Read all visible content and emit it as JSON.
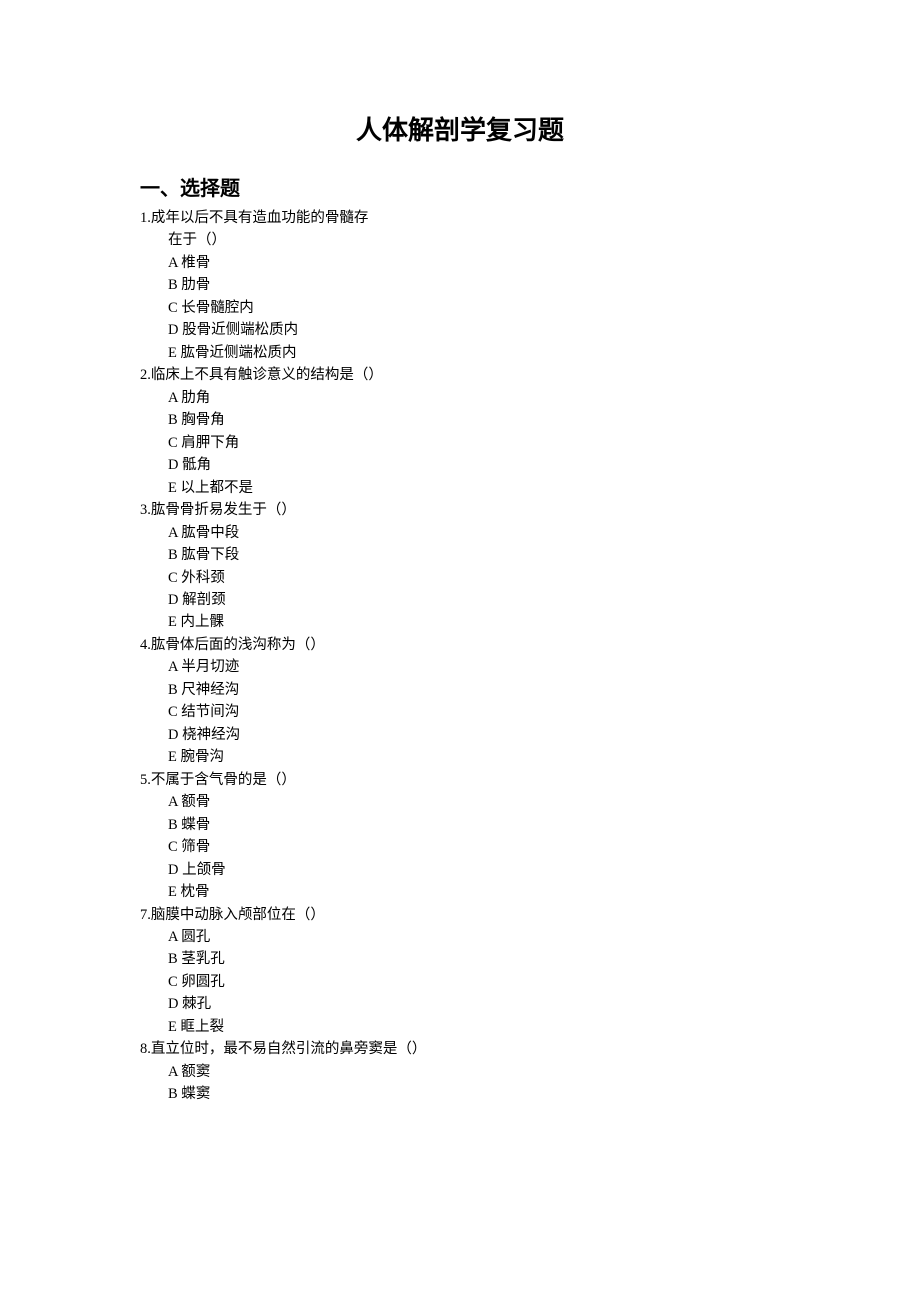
{
  "title": "人体解剖学复习题",
  "section_header": "一、选择题",
  "questions": [
    {
      "number": "1.",
      "text_line1": "成年以后不具有造血功能的骨髓存",
      "text_line2": "在于（）",
      "options": [
        "A 椎骨",
        "B 肋骨",
        "C 长骨髓腔内",
        "D 股骨近侧端松质内",
        "E 肱骨近侧端松质内"
      ]
    },
    {
      "number": "2.",
      "text_line1": "临床上不具有触诊意义的结构是（）",
      "options": [
        "A 肋角",
        "B 胸骨角",
        "C 肩胛下角",
        "D 骶角",
        "E 以上都不是"
      ]
    },
    {
      "number": "3.",
      "text_line1": "肱骨骨折易发生于（）",
      "options": [
        "A 肱骨中段",
        "B 肱骨下段",
        "C 外科颈",
        "D 解剖颈",
        "E 内上髁"
      ]
    },
    {
      "number": "4.",
      "text_line1": "肱骨体后面的浅沟称为（）",
      "options": [
        "A 半月切迹",
        "B 尺神经沟",
        "C 结节间沟",
        "D 桡神经沟",
        "E 腕骨沟"
      ]
    },
    {
      "number": "5.",
      "text_line1": "不属于含气骨的是（）",
      "options": [
        "A 额骨",
        "B 蝶骨",
        "C 筛骨",
        "D 上颌骨",
        "E 枕骨"
      ]
    },
    {
      "number": "7.",
      "text_line1": "脑膜中动脉入颅部位在（）",
      "options": [
        "A 圆孔",
        "B 茎乳孔",
        "C 卵圆孔",
        "D 棘孔",
        "E 眶上裂"
      ]
    },
    {
      "number": "8.",
      "text_line1": "直立位时，最不易自然引流的鼻旁窦是（）",
      "options": [
        "A 额窦",
        "B 蝶窦"
      ]
    }
  ]
}
